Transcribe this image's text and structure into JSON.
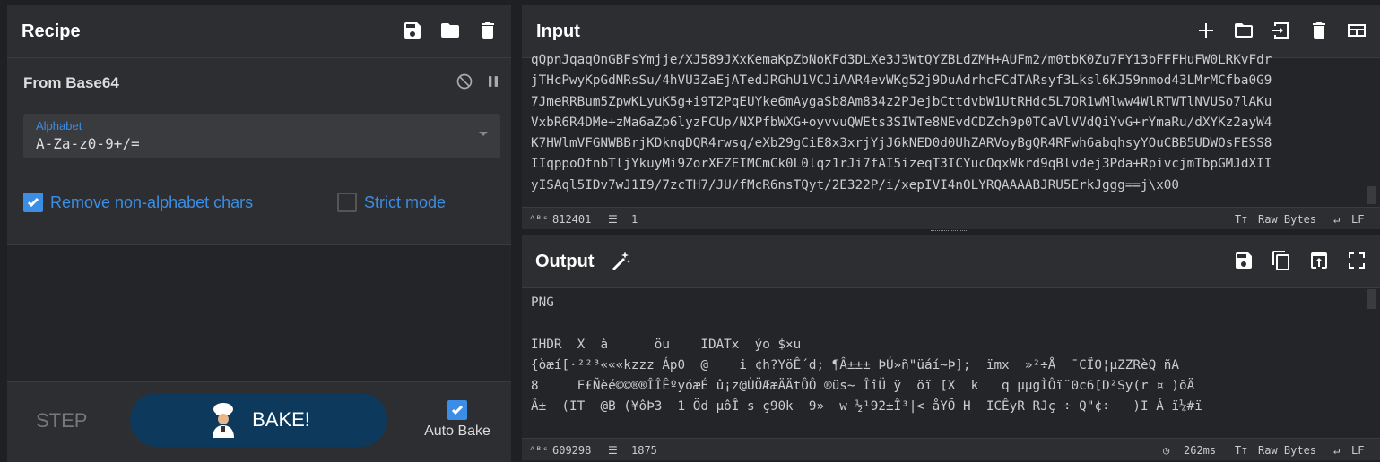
{
  "recipe": {
    "title": "Recipe",
    "icons": [
      "save-icon",
      "folder-icon",
      "trash-icon"
    ],
    "operation": {
      "name": "From Base64",
      "alphabet_label": "Alphabet",
      "alphabet_value": "A-Za-z0-9+/=",
      "remove_nonalpha_label": "Remove non-alphabet chars",
      "remove_nonalpha_checked": true,
      "strict_mode_label": "Strict mode",
      "strict_mode_checked": false
    },
    "controls": {
      "step_label": "STEP",
      "bake_label": "BAKE!",
      "autobake_label": "Auto Bake",
      "autobake_checked": true
    }
  },
  "input": {
    "title": "Input",
    "lines": [
      "qQpnJqaqOnGBFsYmjje/XJ589JXxKemaKpZbNoKFd3DLXe3J3WtQYZBLdZMH+AUFm2/m0tbK0Zu7FY13bFFFHuFW0LRKvFdr",
      "jTHcPwyKpGdNRsSu/4hVU3ZaEjATedJRGhU1VCJiAAR4evWKg52j9DuAdrhcFCdTARsyf3Lksl6KJ59nmod43LMrMCfba0G9",
      "7JmeRRBum5ZpwKLyuK5g+i9T2PqEUYke6mAygaSb8Am834z2PJejbCttdvbW1UtRHdc5L7OR1wMlww4WlRTWTlNVUSo7lAKu",
      "VxbR6R4DMe+zMa6aZp6lyzFCUp/NXPfbWXG+oyvvuQWEts3SIWTe8NEvdCDZch9p0TCaVlVVdQiYvG+rYmaRu/dXYKz2ayW4",
      "K7HWlmVFGNWBBrjKDknqDQR4rwsq/eXb29gCiE8x3xrjYjJ6kNED0d0UhZARVoyBgQR4RFwh6abqhsyYOuCBB5UDWOsFESS8",
      "IIqppoOfnbTljYkuyMi9ZorXEZEIMCmCk0L0lqz1rJi7fAI5izeqT3ICYucOqxWkrd9qBlvdej3Pda+RpivcjmTbpGMJdXII",
      "yISAql5IDv7wJ1I9/7zcTH7/JU/fMcR6nsTQyt/2E322P/i/xepIVI4nOLYRQAAAABJRU5ErkJggg==j\\x00"
    ],
    "stats": {
      "length": "812401",
      "lines": "1"
    },
    "encoding": "Raw Bytes",
    "eol": "LF",
    "icons": [
      "plus-icon",
      "folder-icon",
      "import-icon",
      "trash-icon",
      "layout-icon"
    ]
  },
  "output": {
    "title": "Output",
    "lines": [
      "PNG",
      "",
      "IHDR  X  à      öu    IDATx  ýo $×u",
      "{òæí[·²²³«««kzzz Áp0  @    i ¢h?YöÊ´d; ¶Â±±±_ÞÚ»ñ\"üáí~Þ];  ïmx  »²÷Å  ¯CÏO¦µZZRèQ ñA",
      "8     F£Ñèé©©®®ÎÎÊºyóæÉ û¡z@ÙÖÆæÄÄtÔÔ ®üs~ ÎîÜ ÿ  öï [X  k   q µµgÌÔï¨0c6[D²Sy(r ¤ )õÄ",
      "Â±  (IT  @B (¥ôÞ3  1 Öd µôÎ s ç90k  9»  w ½¹92±Î³|< åYÕ H  ICÊyR RJç ÷ Q\"¢÷   )I Á ï¼#ï"
    ],
    "stats": {
      "length": "609298",
      "lines": "1875"
    },
    "time": "262ms",
    "encoding": "Raw Bytes",
    "eol": "LF",
    "icons": [
      "save-icon",
      "copy-icon",
      "replace-input-icon",
      "maximize-icon",
      "magic-wand-icon"
    ]
  }
}
